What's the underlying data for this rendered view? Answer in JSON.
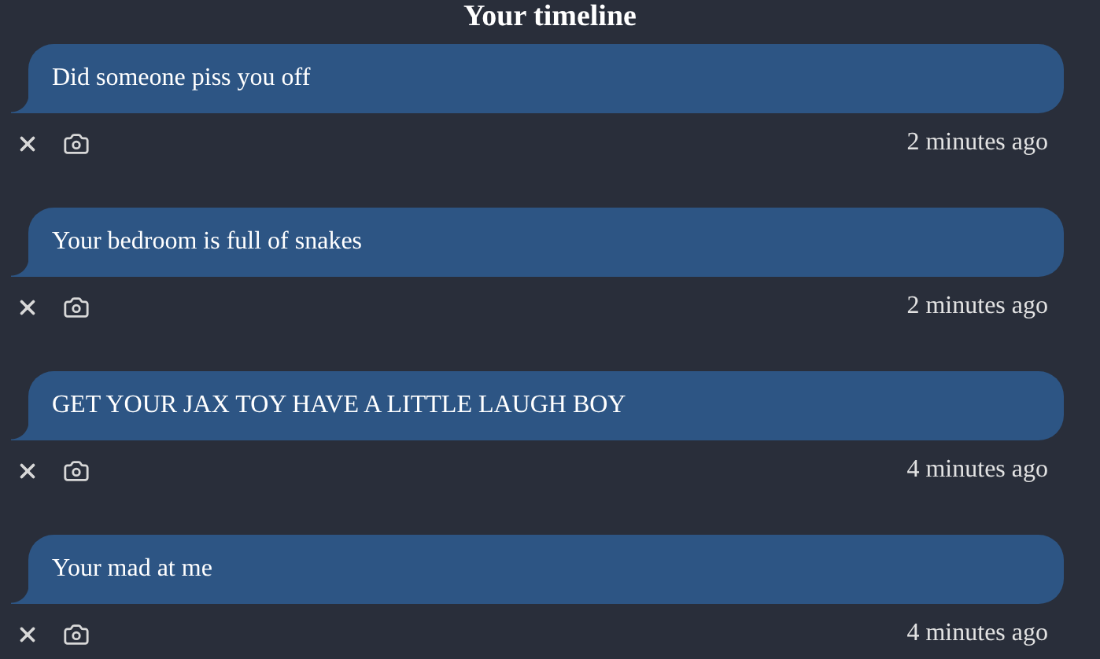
{
  "title": "Your timeline",
  "posts": [
    {
      "text": "Did someone piss you off",
      "time": "2 minutes ago"
    },
    {
      "text": "Your bedroom is full of snakes",
      "time": "2 minutes ago"
    },
    {
      "text": "GET YOUR JAX TOY HAVE A LITTLE LAUGH BOY",
      "time": "4 minutes ago"
    },
    {
      "text": "Your mad at me",
      "time": "4 minutes ago"
    }
  ]
}
